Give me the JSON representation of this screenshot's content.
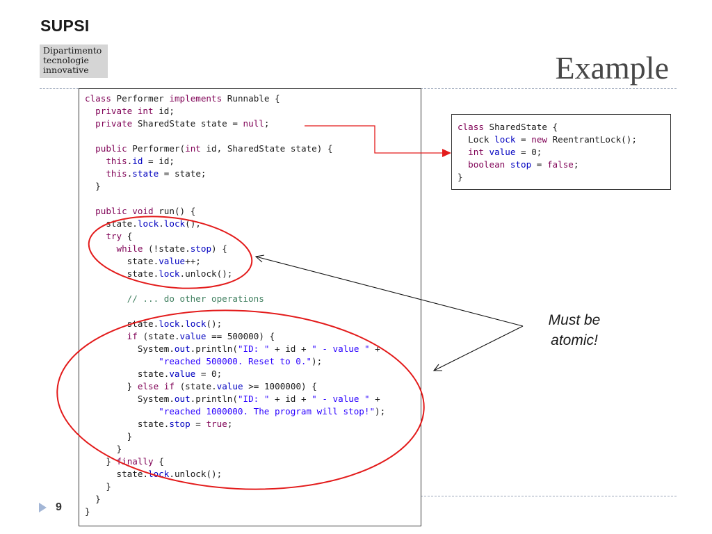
{
  "logo": {
    "name": "SUPSI",
    "dept_lines": [
      "Dipartimento",
      "tecnologie",
      "innovative"
    ]
  },
  "title": "Example",
  "code_lines": [
    "class Performer implements Runnable {",
    "  private int id;",
    "  private SharedState state = null;",
    "",
    "  public Performer(int id, SharedState state) {",
    "    this.id = id;",
    "    this.state = state;",
    "  }",
    "",
    "  public void run() {",
    "    state.lock.lock();",
    "    try {",
    "      while (!state.stop) {",
    "        state.value++;",
    "        state.lock.unlock();",
    "",
    "        // ... do other operations",
    "",
    "        state.lock.lock();",
    "        if (state.value == 500000) {",
    "          System.out.println(\"ID: \" + id + \" - value \" +",
    "              \"reached 500000. Reset to 0.\");",
    "          state.value = 0;",
    "        } else if (state.value >= 1000000) {",
    "          System.out.println(\"ID: \" + id + \" - value \" +",
    "              \"reached 1000000. The program will stop!\");",
    "          state.stop = true;",
    "        }",
    "      }",
    "    } finally {",
    "      state.lock.unlock();",
    "    }",
    "  }",
    "}"
  ],
  "shared_state_lines": [
    "class SharedState {",
    "  Lock lock = new ReentrantLock();",
    "  int value = 0;",
    "  boolean stop = false;",
    "}"
  ],
  "note_lines": [
    "Must be",
    "atomic!"
  ],
  "page_number": "9",
  "colors": {
    "keyword": "#7f0055",
    "field": "#0000c0",
    "string": "#2a00ff",
    "comment": "#3f7f5f",
    "highlight_ellipse": "#e31b1b",
    "rule": "#9aa5b8",
    "bullet": "#a3b6d6"
  }
}
